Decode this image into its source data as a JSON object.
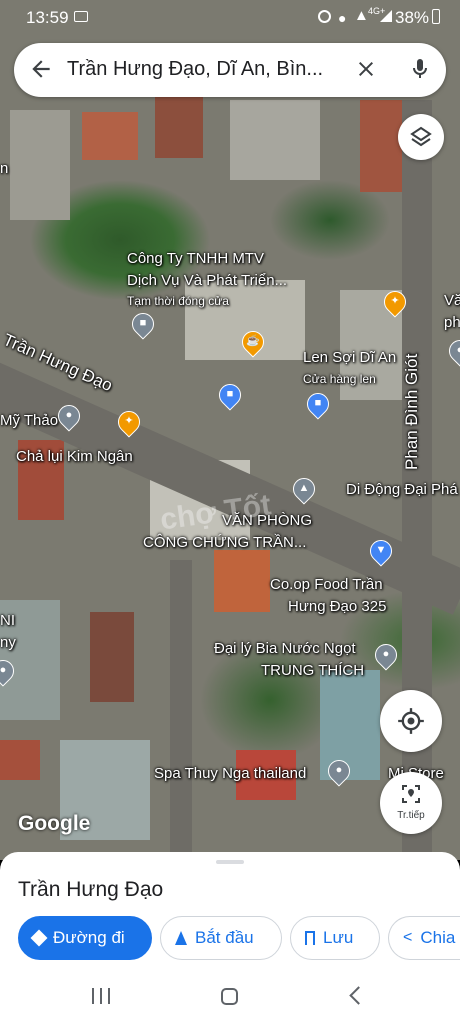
{
  "status_bar": {
    "time": "13:59",
    "network": "4G+",
    "battery": "38%"
  },
  "search": {
    "query": "Trần Hưng Đạo, Dĩ An, Bìn..."
  },
  "map": {
    "street_labels": [
      "Trần Hưng Đạo",
      "Phan Đình Giót"
    ],
    "places": [
      {
        "name": "Công Ty TNHH MTV",
        "name2": "Dịch Vụ Và Phát Triển...",
        "note": "Tạm thời đóng cửa"
      },
      {
        "name": "Len Sợi Dĩ An",
        "note": "Cửa hàng len"
      },
      {
        "name": "Mỹ Thảo"
      },
      {
        "name": "Chả lụi Kim Ngân"
      },
      {
        "name": "Di Động Đại Phá"
      },
      {
        "name": "VĂN PHÒNG",
        "name2": "CÔNG CHỨNG TRẦN..."
      },
      {
        "name": "Co.op Food Trần",
        "name2": "Hưng Đạo 325"
      },
      {
        "name": "Đại lý Bia Nước Ngọt",
        "name2": "TRUNG THÍCH"
      },
      {
        "name": "Spa Thuy Nga thailand"
      },
      {
        "name": "Mi Store"
      }
    ],
    "edge_fragments": [
      "Vă",
      "ph",
      "NI",
      "ny",
      "n"
    ],
    "watermark": "Google",
    "overlay_watermark": "chợ Tốt"
  },
  "controls": {
    "go_label": "Tr.tiếp"
  },
  "sheet": {
    "title": "Trần Hưng Đạo",
    "actions": [
      "Đường đi",
      "Bắt đầu",
      "Lưu",
      "Chia"
    ]
  },
  "colors": {
    "accent": "#1a73e8",
    "pin_blue": "#4285f4",
    "pin_orange": "#f29900",
    "pin_grey": "#7a8793"
  }
}
